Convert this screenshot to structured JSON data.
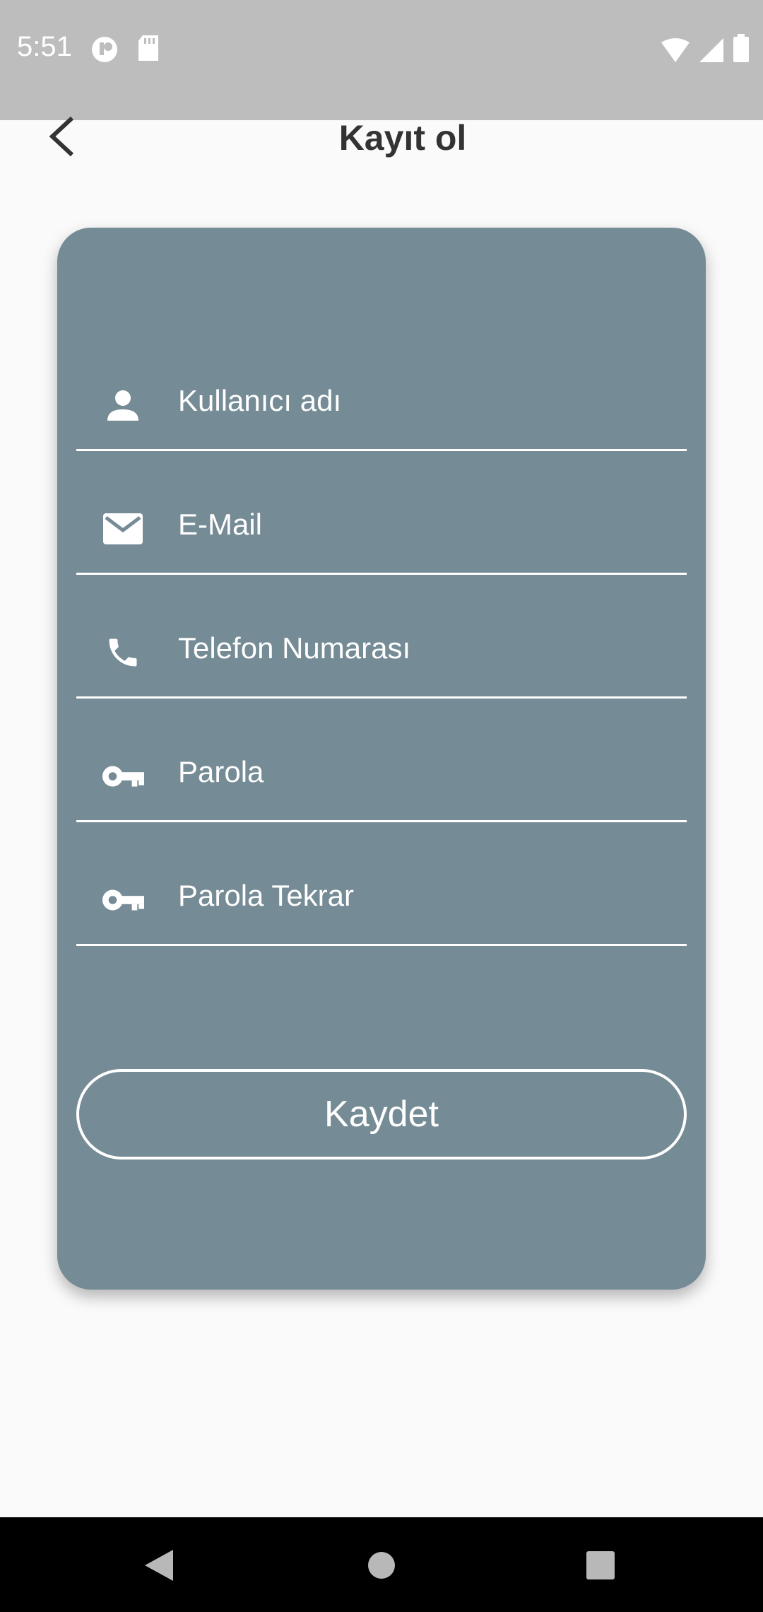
{
  "status_bar": {
    "time": "5:51",
    "icons_left": [
      "app-notification-icon",
      "sd-card-icon"
    ],
    "icons_right": [
      "wifi-icon",
      "cellular-signal-icon",
      "battery-icon"
    ]
  },
  "app_bar": {
    "title": "Kayıt ol",
    "back_icon": "chevron-left-icon"
  },
  "form": {
    "fields": [
      {
        "placeholder": "Kullanıcı adı",
        "icon": "person-icon"
      },
      {
        "placeholder": "E-Mail",
        "icon": "mail-icon"
      },
      {
        "placeholder": "Telefon Numarası",
        "icon": "phone-icon"
      },
      {
        "placeholder": "Parola",
        "icon": "key-icon"
      },
      {
        "placeholder": "Parola Tekrar",
        "icon": "key-icon"
      }
    ],
    "save_label": "Kaydet"
  },
  "colors": {
    "card_background": "#758b95",
    "page_background": "#fafafa",
    "status_bar": "#bdbdbd",
    "navigation_bar": "#000000"
  },
  "nav_bar": {
    "buttons": [
      "back-triangle-icon",
      "home-circle-icon",
      "recents-square-icon"
    ]
  }
}
